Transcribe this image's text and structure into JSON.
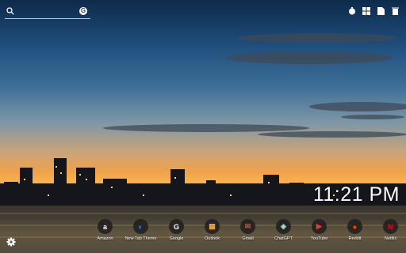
{
  "clock": {
    "time": "11:21 PM"
  },
  "search": {
    "placeholder": ""
  },
  "shortcuts": [
    {
      "label": "Amazon",
      "glyph": "a",
      "color": "#222222"
    },
    {
      "label": "New Tab Theme",
      "glyph": "◐",
      "color": "#1e6fd9"
    },
    {
      "label": "Google",
      "glyph": "G",
      "color": "#ffffff"
    },
    {
      "label": "Outlook",
      "glyph": "▦",
      "color": "#f2a33a"
    },
    {
      "label": "Gmail",
      "glyph": "✉",
      "color": "#ea4335"
    },
    {
      "label": "ChatGPT",
      "glyph": "◈",
      "color": "#a8d8d0"
    },
    {
      "label": "YouTube",
      "glyph": "▶",
      "color": "#ff0000"
    },
    {
      "label": "Reddit",
      "glyph": "●",
      "color": "#ff4500"
    },
    {
      "label": "Netflix",
      "glyph": "N",
      "color": "#e50914"
    }
  ],
  "toolbar_icons": [
    "timer-icon",
    "apps-grid-icon",
    "document-icon",
    "trash-icon"
  ]
}
